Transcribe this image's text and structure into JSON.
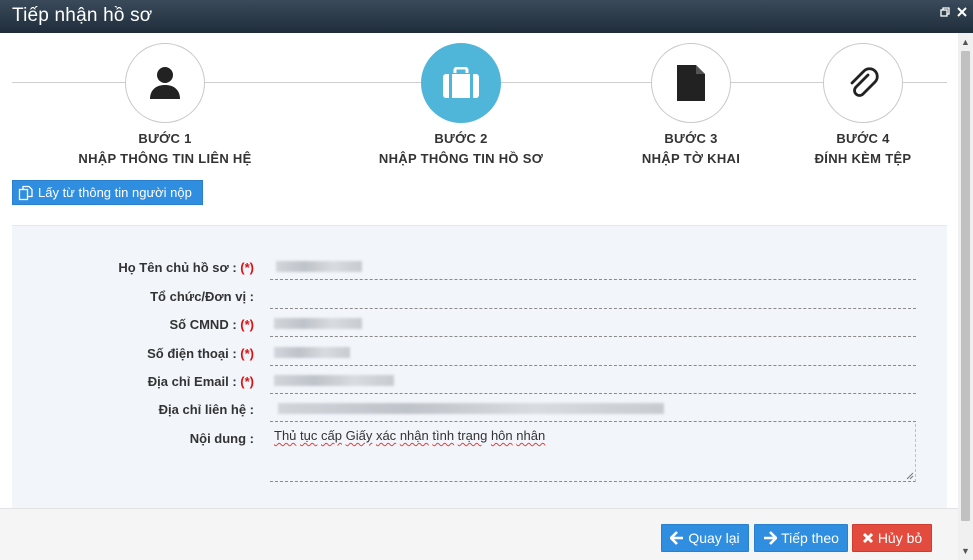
{
  "window": {
    "title": "Tiếp nhận hồ sơ",
    "restore_icon": "restore-icon",
    "close_icon": "close-icon"
  },
  "steps": [
    {
      "number": "BƯỚC 1",
      "name": "NHẬP THÔNG TIN LIÊN HỆ",
      "icon": "user-icon",
      "active": false
    },
    {
      "number": "BƯỚC 2",
      "name": "NHẬP THÔNG TIN HỒ SƠ",
      "icon": "briefcase-icon",
      "active": true
    },
    {
      "number": "BƯỚC 3",
      "name": "NHẬP TỜ KHAI",
      "icon": "document-icon",
      "active": false
    },
    {
      "number": "BƯỚC 4",
      "name": "ĐÍNH KÈM TỆP",
      "icon": "paperclip-icon",
      "active": false
    }
  ],
  "fill_button": {
    "label": "Lấy từ thông tin người nộp",
    "icon": "copy-icon"
  },
  "form": {
    "fields": [
      {
        "label": "Họ Tên chủ hồ sơ :",
        "required": "(*)"
      },
      {
        "label": "Tổ chức/Đơn vị :",
        "required": ""
      },
      {
        "label": "Số CMND :",
        "required": "(*)"
      },
      {
        "label": "Số điện thoại :",
        "required": "(*)"
      },
      {
        "label": "Địa chỉ Email :",
        "required": "(*)"
      },
      {
        "label": "Địa chỉ liên hệ :",
        "required": ""
      }
    ],
    "content_label": "Nội dung :",
    "content_words": [
      "Thủ",
      "tục",
      "cấp",
      "Giấy",
      "xác",
      "nhận",
      "tình",
      "trạng",
      "hôn",
      "nhân"
    ]
  },
  "footer": {
    "back_label": "Quay lại",
    "next_label": "Tiếp theo",
    "cancel_label": "Hủy bỏ"
  },
  "colors": {
    "active_step": "#4fb6d9",
    "primary_button": "#2f8ee0",
    "cancel_button": "#e24b3d",
    "required_mark": "#e01010"
  }
}
